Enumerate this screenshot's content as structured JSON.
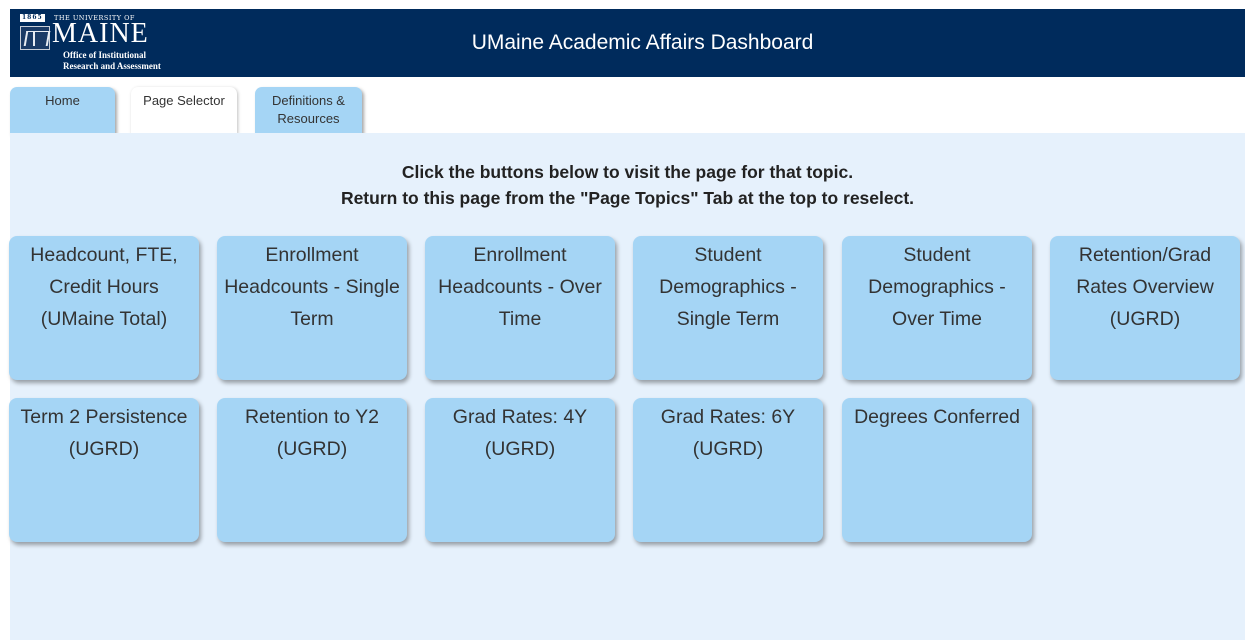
{
  "header": {
    "title": "UMaine Academic Affairs Dashboard",
    "logo": {
      "year": "1865",
      "university_line": "THE UNIVERSITY OF",
      "name": "MAINE",
      "office_line1": "Office of Institutional",
      "office_line2": "Research and Assessment"
    }
  },
  "tabs": [
    {
      "label": "Home",
      "active": false
    },
    {
      "label": "Page Selector",
      "active": true
    },
    {
      "label": "Definitions &\nResources",
      "active": false
    }
  ],
  "instructions": {
    "line1": "Click the buttons below to visit the page for that topic.",
    "line2": "Return to this page from the \"Page Topics\" Tab at the top to reselect."
  },
  "tiles": [
    {
      "label": "Headcount, FTE, Credit Hours (UMaine Total)"
    },
    {
      "label": "Enrollment Headcounts - Single Term"
    },
    {
      "label": "Enrollment Headcounts - Over Time"
    },
    {
      "label": "Student Demographics - Single Term"
    },
    {
      "label": "Student Demographics - Over Time"
    },
    {
      "label": "Retention/Grad Rates Overview (UGRD)"
    },
    {
      "label": "Term 2 Persistence (UGRD)"
    },
    {
      "label": "Retention to Y2 (UGRD)"
    },
    {
      "label": "Grad Rates: 4Y (UGRD)"
    },
    {
      "label": "Grad Rates: 6Y (UGRD)"
    },
    {
      "label": "Degrees Conferred"
    }
  ],
  "colors": {
    "header_bg": "#002b5c",
    "tile_bg": "#a5d5f5",
    "content_bg": "#e6f1fc"
  }
}
